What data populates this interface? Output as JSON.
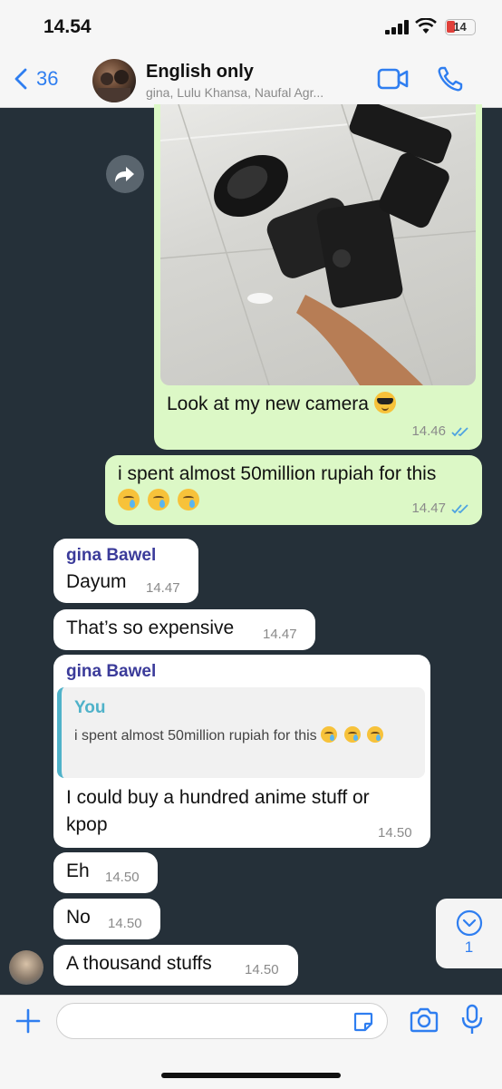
{
  "status_bar": {
    "time": "14.54",
    "battery": "14"
  },
  "header": {
    "back_count": "36",
    "title": "English only",
    "subtitle": "gina, Lulu Khansa, Naufal Agr..."
  },
  "messages": {
    "m1": {
      "text": "Look at my new camera",
      "emoji": "sunglasses-face",
      "time": "14.46",
      "status": "read"
    },
    "m2": {
      "text": "i spent almost 50million rupiah for this",
      "emoji": "crying-face x3",
      "time": "14.47",
      "status": "read"
    },
    "m3": {
      "sender": "gina Bawel",
      "text": "Dayum",
      "time": "14.47"
    },
    "m4": {
      "text": "That’s so expensive",
      "time": "14.47"
    },
    "m5": {
      "sender": "gina Bawel",
      "quote_name": "You",
      "quote_text": "i spent almost 50million rupiah for this",
      "text": "I could buy a hundred anime stuff or kpop",
      "time": "14.50"
    },
    "m6": {
      "text": "Eh",
      "time": "14.50"
    },
    "m7": {
      "text": "No",
      "time": "14.50"
    },
    "m8": {
      "text": "A thousand stuffs",
      "time": "14.50"
    }
  },
  "scroll_badge": {
    "count": "1"
  },
  "input": {
    "placeholder": ""
  },
  "colors": {
    "accent": "#2f7ef0",
    "outgoing": "#dcf8c6",
    "incoming": "#ffffff",
    "background": "#253039",
    "sender": "#3b3b9a",
    "quote": "#4fb2c9",
    "read_ticks": "#4fa3e0"
  }
}
